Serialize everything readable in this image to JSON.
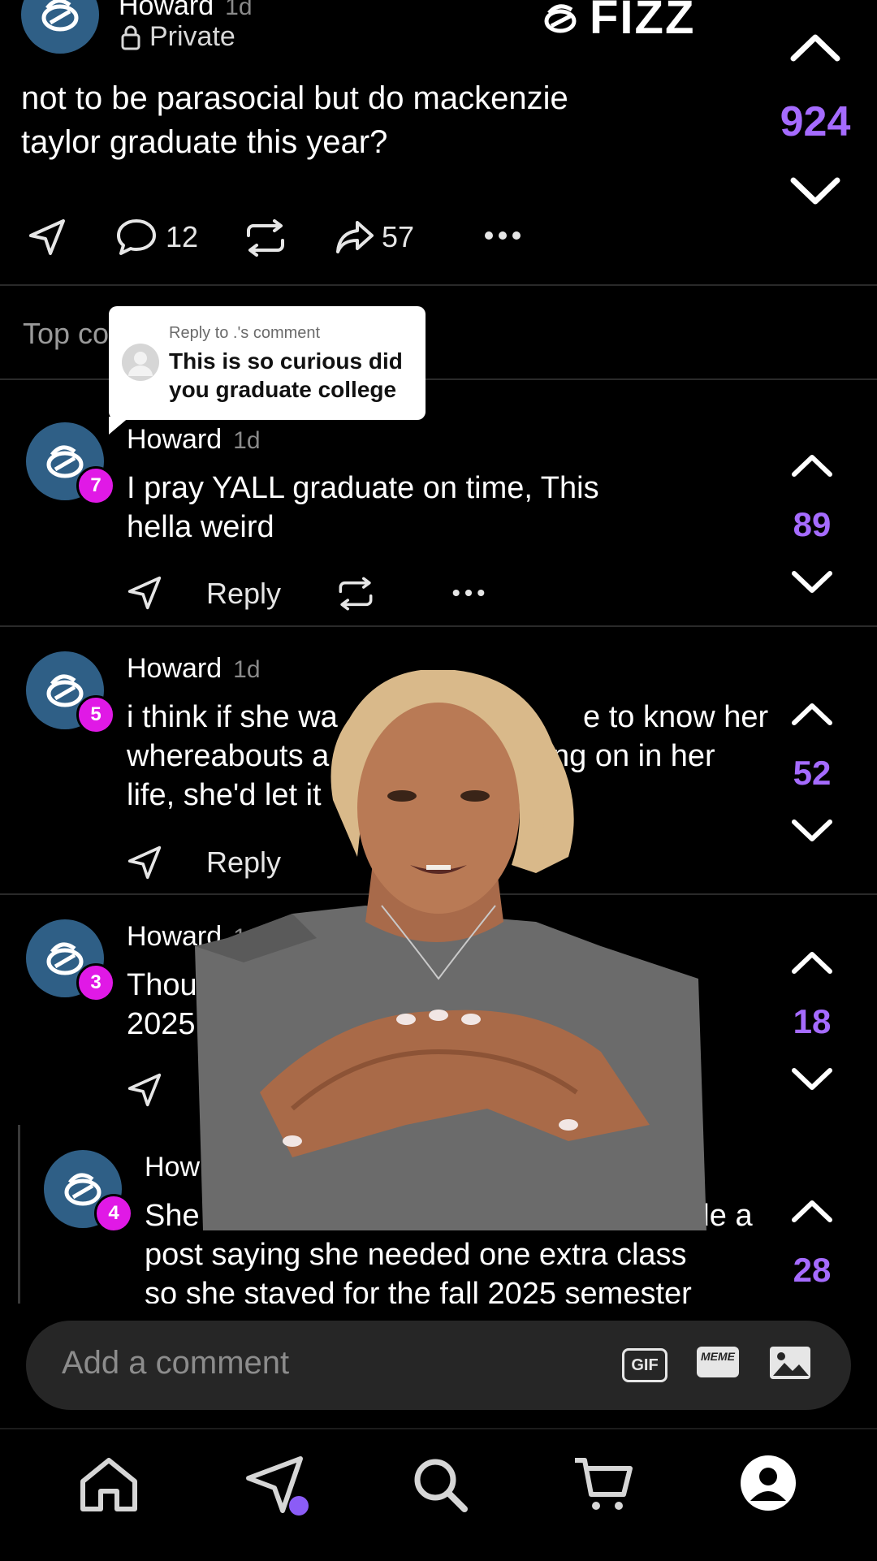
{
  "post": {
    "author": "Howard",
    "time": "1d",
    "privacy": "Private",
    "text_line1": "not to be parasocial but do mackenzie",
    "text_line2": "taylor graduate this year?",
    "votes": "924",
    "comments_count": "12",
    "shares_count": "57"
  },
  "brand": {
    "name": "FIZZ"
  },
  "sort_label": "Top co",
  "reply_card": {
    "title": "Reply to .'s comment",
    "line1": "This is so curious did",
    "line2": "you graduate college"
  },
  "comments": [
    {
      "author": "Howard",
      "time": "1d",
      "badge": "7",
      "line1": "I pray YALL graduate on time, This",
      "line2": "hella weird",
      "votes": "89",
      "reply_label": "Reply"
    },
    {
      "author": "Howard",
      "time": "1d",
      "badge": "5",
      "line1": "i think if she wa",
      "line1b": "e to know her",
      "line2": "whereabouts a",
      "line2b": "ng on in her",
      "line3": "life, she'd let it",
      "votes": "52",
      "reply_label": "Reply"
    },
    {
      "author": "Howard",
      "time": "1d",
      "badge": "3",
      "line1": "Though",
      "line2": "2025",
      "votes": "18"
    },
    {
      "author": "How",
      "badge": "4",
      "line1": "She",
      "line1b": "she made a",
      "line2": "post saying she needed one extra class",
      "line3": "so she staved for the fall 2025 semester",
      "votes": "28"
    }
  ],
  "composer": {
    "placeholder": "Add a comment",
    "gif_label": "GIF",
    "meme_label": "MEME"
  },
  "nav": {
    "items": [
      "home-icon",
      "send-icon",
      "search-icon",
      "cart-icon",
      "profile-icon"
    ],
    "active": "profile-icon"
  },
  "colors": {
    "accent": "#a56bff",
    "badge": "#e019e6",
    "avatar": "#2f5f86"
  }
}
